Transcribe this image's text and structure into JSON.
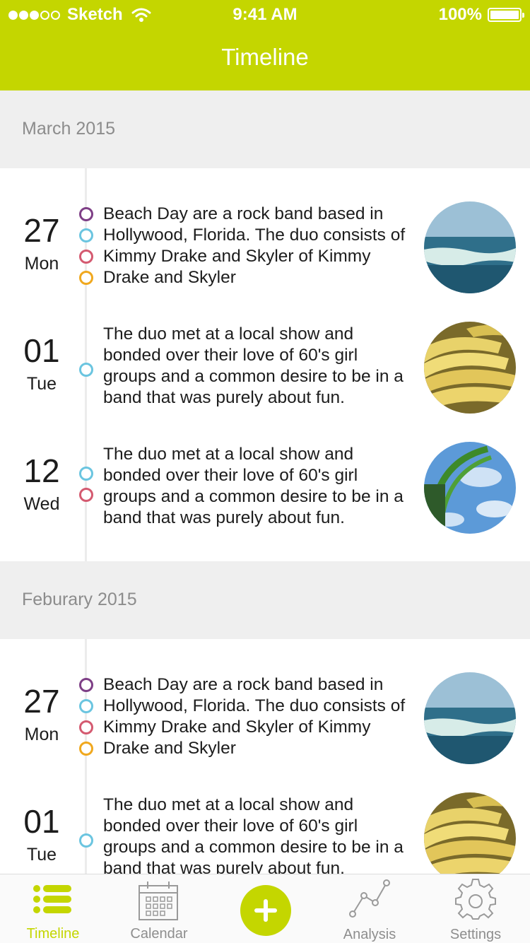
{
  "status_bar": {
    "carrier": "Sketch",
    "time": "9:41 AM",
    "battery": "100%",
    "signal_bars_filled": 3,
    "signal_bars_total": 5
  },
  "header": {
    "title": "Timeline",
    "bg_color": "#c4d600"
  },
  "colors": {
    "accent": "#c4d600",
    "purple": "#7e3f86",
    "blue": "#6bc5e0",
    "red": "#d45a70",
    "orange": "#f0a81e"
  },
  "sections": [
    {
      "month": "March 2015",
      "entries": [
        {
          "day": "27",
          "weekday": "Mon",
          "text": "Beach Day are a rock band based in Hollywood, Florida. The duo consists of Kimmy Drake and Skyler of Kimmy Drake and Skyler",
          "tags": [
            "purple",
            "blue",
            "red",
            "orange"
          ],
          "photo": "ocean-photo"
        },
        {
          "day": "01",
          "weekday": "Tue",
          "text": "The duo met at a local show and bonded over their love of 60's girl groups and a common desire to be in a band that was purely about fun.",
          "tags": [
            "blue"
          ],
          "photo": "bananas-photo"
        },
        {
          "day": "12",
          "weekday": "Wed",
          "text": "The duo met at a local show and bonded over their love of 60's girl groups and a common desire to be in a band that was purely about fun.",
          "tags": [
            "blue",
            "red"
          ],
          "photo": "rollercoaster-photo"
        }
      ]
    },
    {
      "month": "Feburary 2015",
      "entries": [
        {
          "day": "27",
          "weekday": "Mon",
          "text": "Beach Day are a rock band based in Hollywood, Florida. The duo consists of Kimmy Drake and Skyler of Kimmy Drake and Skyler",
          "tags": [
            "purple",
            "blue",
            "red",
            "orange"
          ],
          "photo": "ocean-photo"
        },
        {
          "day": "01",
          "weekday": "Tue",
          "text": "The duo met at a local show and bonded over their love of 60's girl groups and a common desire to be in a band that was purely about fun.",
          "tags": [
            "blue"
          ],
          "photo": "bananas-photo"
        }
      ]
    }
  ],
  "tabbar": {
    "timeline": "Timeline",
    "calendar": "Calendar",
    "add_icon": "plus-icon",
    "analysis": "Analysis",
    "settings": "Settings"
  }
}
